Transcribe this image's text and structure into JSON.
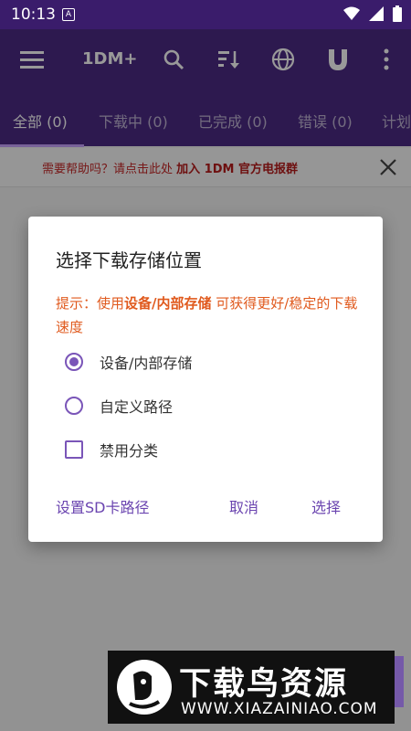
{
  "status": {
    "time": "10:13",
    "notif": "A"
  },
  "appbar": {
    "title": "1DM+",
    "icons": [
      "menu-icon",
      "search-icon",
      "sort-icon",
      "globe-icon",
      "magnet-icon",
      "more-vert-icon"
    ]
  },
  "tabs": [
    {
      "label": "全部 (0)",
      "active": true
    },
    {
      "label": "下载中 (0)",
      "active": false
    },
    {
      "label": "已完成 (0)",
      "active": false
    },
    {
      "label": "错误 (0)",
      "active": false
    },
    {
      "label": "计划",
      "active": false
    }
  ],
  "help_banner": {
    "text": "需要帮助吗？请点击此处",
    "link": "加入 1DM 官方电报群"
  },
  "dialog": {
    "title": "选择下载存储位置",
    "hint_prefix": "提示：使用",
    "hint_bold": "设备/内部存储",
    "hint_suffix": " 可获得更好/稳定的下载速度",
    "options": [
      {
        "label": "设备/内部存储",
        "type": "radio",
        "selected": true
      },
      {
        "label": "自定义路径",
        "type": "radio",
        "selected": false
      },
      {
        "label": "禁用分类",
        "type": "checkbox",
        "checked": false
      }
    ],
    "buttons": {
      "sd": "设置SD卡路径",
      "cancel": "取消",
      "confirm": "选择"
    }
  },
  "watermark": {
    "title": "下载鸟资源",
    "url": "WWW.XIAZAINIAO.COM"
  },
  "colors": {
    "primary": "#4b2a84",
    "accent": "#7a55b8",
    "hint": "#e05a1e",
    "banner": "#c62828"
  }
}
